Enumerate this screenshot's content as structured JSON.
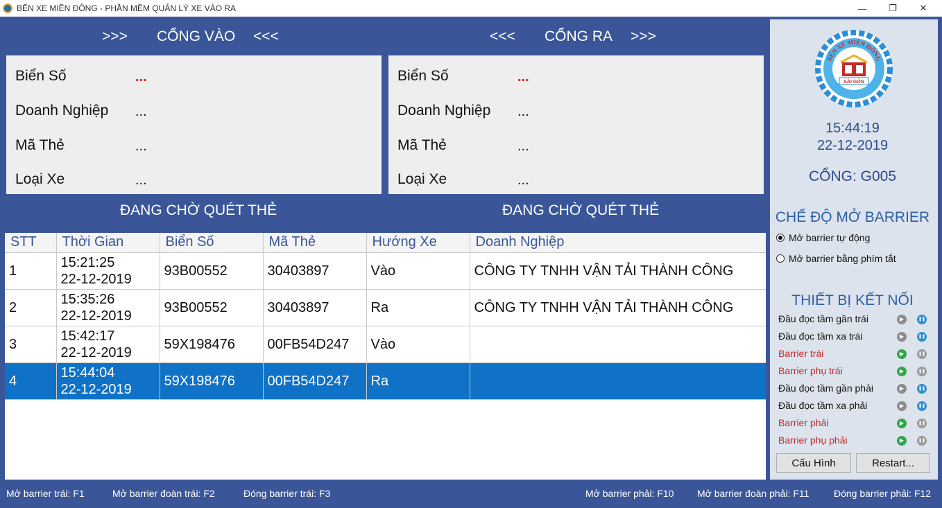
{
  "window": {
    "title": "BẾN XE MIỀN ĐÔNG - PHẦN MỀM QUẢN LÝ XE VÀO RA",
    "minimize": "—",
    "restore": "❐",
    "close": "✕"
  },
  "gate_in": {
    "arrows_left": ">>>",
    "title": "CỔNG VÀO",
    "arrows_right": "<<<",
    "plate_label": "Biển Số",
    "plate_value": "...",
    "company_label": "Doanh Nghiệp",
    "company_value": "...",
    "card_label": "Mã Thẻ",
    "card_value": "...",
    "type_label": "Loại Xe",
    "type_value": "...",
    "status": "ĐANG CHỜ QUÉT THẺ"
  },
  "gate_out": {
    "arrows_left": "<<<",
    "title": "CỔNG RA",
    "arrows_right": ">>>",
    "plate_label": "Biển Số",
    "plate_value": "...",
    "company_label": "Doanh Nghiệp",
    "company_value": "...",
    "card_label": "Mã Thẻ",
    "card_value": "...",
    "type_label": "Loại Xe",
    "type_value": "...",
    "status": "ĐANG CHỜ QUÉT THẺ"
  },
  "table": {
    "headers": [
      "STT",
      "Thời Gian",
      "Biển Số",
      "Mã Thẻ",
      "Hướng Xe",
      "Doanh Nghiệp"
    ],
    "rows": [
      {
        "stt": "1",
        "time": "15:21:25",
        "date": "22-12-2019",
        "plate": "93B00552",
        "card": "30403897",
        "direction": "Vào",
        "company": "CÔNG TY TNHH VẬN TẢI THÀNH CÔNG"
      },
      {
        "stt": "2",
        "time": "15:35:26",
        "date": "22-12-2019",
        "plate": "93B00552",
        "card": "30403897",
        "direction": "Ra",
        "company": "CÔNG TY TNHH VẬN TẢI THÀNH CÔNG"
      },
      {
        "stt": "3",
        "time": "15:42:17",
        "date": "22-12-2019",
        "plate": "59X198476",
        "card": "00FB54D247",
        "direction": "Vào",
        "company": ""
      },
      {
        "stt": "4",
        "time": "15:44:04",
        "date": "22-12-2019",
        "plate": "59X198476",
        "card": "00FB54D247",
        "direction": "Ra",
        "company": ""
      }
    ]
  },
  "sidebar": {
    "logo_text_top": "BẾN XE MIỀN ĐÔNG",
    "logo_text_bottom": "SÀI GÒN",
    "clock_time": "15:44:19",
    "clock_date": "22-12-2019",
    "gate_code": "CỔNG: G005",
    "barrier_mode_title": "CHẾ ĐỘ MỞ BARRIER",
    "barrier_auto": "Mở barrier tự động",
    "barrier_shortcut": "Mở barrier bằng phím tắt",
    "devices_title": "THIẾT BỊ KẾT NỐI",
    "devices": [
      {
        "label": "Đầu đọc tầm gần trái",
        "play_icon": "play-icon",
        "play_color": "#8c8c8c",
        "pause_icon": "pause-icon",
        "pause_color": "#2f8fd0"
      },
      {
        "label": "Đầu đọc tầm xa trái",
        "play_icon": "play-icon",
        "play_color": "#8c8c8c",
        "pause_icon": "pause-icon",
        "pause_color": "#2f8fd0"
      },
      {
        "label": "Barrier trái",
        "play_icon": "play-icon",
        "play_color": "#2ea84a",
        "pause_icon": "pause-icon",
        "pause_color": "#9a9a9a"
      },
      {
        "label": "Barrier phụ trái",
        "play_icon": "play-icon",
        "play_color": "#2ea84a",
        "pause_icon": "pause-icon",
        "pause_color": "#9a9a9a"
      },
      {
        "label": "Đầu đọc tầm gần phải",
        "play_icon": "play-icon",
        "play_color": "#8c8c8c",
        "pause_icon": "pause-icon",
        "pause_color": "#2f8fd0"
      },
      {
        "label": "Đầu đọc tầm xa phải",
        "play_icon": "play-icon",
        "play_color": "#8c8c8c",
        "pause_icon": "pause-icon",
        "pause_color": "#2f8fd0"
      },
      {
        "label": "Barrier phải",
        "play_icon": "play-icon",
        "play_color": "#2ea84a",
        "pause_icon": "pause-icon",
        "pause_color": "#9a9a9a"
      },
      {
        "label": "Barrier phụ phải",
        "play_icon": "play-icon",
        "play_color": "#2ea84a",
        "pause_icon": "pause-icon",
        "pause_color": "#9a9a9a"
      }
    ],
    "config_button": "Cấu Hình",
    "restart_button": "Restart..."
  },
  "footer": {
    "left": [
      "Mở barrier trái: F1",
      "Mở barrier đoàn trái: F2",
      "Đóng barrier trái: F3"
    ],
    "right": [
      "Mở barrier phải: F10",
      "Mở barrier đoàn phải: F11",
      "Đóng barrier phải: F12"
    ]
  },
  "colors": {
    "panel_blue": "#3a5699",
    "selected_row": "#0f72c7",
    "alert_red": "#c0282d"
  }
}
